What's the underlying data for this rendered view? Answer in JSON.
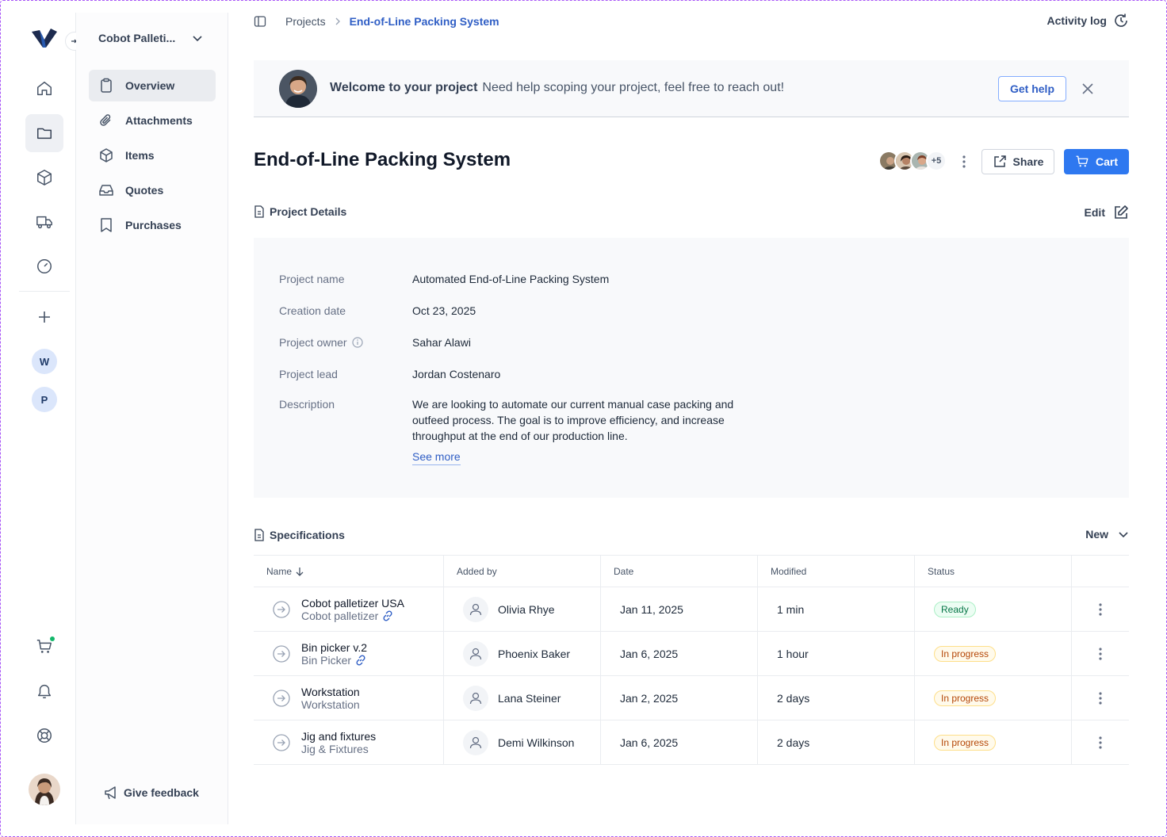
{
  "sidebar": {
    "project_selector": "Cobot Palleti...",
    "items": [
      {
        "label": "Overview",
        "icon": "clipboard-icon"
      },
      {
        "label": "Attachments",
        "icon": "paperclip-icon"
      },
      {
        "label": "Items",
        "icon": "box-icon"
      },
      {
        "label": "Quotes",
        "icon": "inbox-icon"
      },
      {
        "label": "Purchases",
        "icon": "bookmark-icon"
      }
    ],
    "feedback": "Give feedback"
  },
  "rail": {
    "workspaces": [
      "W",
      "P"
    ]
  },
  "breadcrumb": {
    "root": "Projects",
    "current": "End-of-Line Packing System"
  },
  "header": {
    "activity_log": "Activity log"
  },
  "banner": {
    "title": "Welcome to your project",
    "message": "Need help scoping your project, feel free to reach out!",
    "button": "Get help"
  },
  "project": {
    "title": "End-of-Line Packing System",
    "collaborators_more": "+5",
    "share": "Share",
    "cart": "Cart"
  },
  "details": {
    "heading": "Project Details",
    "edit": "Edit",
    "rows": {
      "name_label": "Project name",
      "name_value": "Automated End-of-Line Packing System",
      "date_label": "Creation date",
      "date_value": "Oct 23, 2025",
      "owner_label": "Project owner",
      "owner_value": "Sahar Alawi",
      "lead_label": "Project lead",
      "lead_value": "Jordan Costenaro",
      "desc_label": "Description",
      "desc_value": "We are looking to automate our current manual case packing and outfeed process. The goal is to improve efficiency, and increase throughput at the end of our production line.",
      "see_more": "See more"
    }
  },
  "specs": {
    "heading": "Specifications",
    "new": "New",
    "columns": [
      "Name",
      "Added by",
      "Date",
      "Modified",
      "Status"
    ],
    "rows": [
      {
        "name": "Cobot palletizer USA",
        "type": "Cobot palletizer",
        "added_by": "Olivia Rhye",
        "date": "Jan 11, 2025",
        "modified": "1 min",
        "status": "Ready"
      },
      {
        "name": "Bin picker v.2",
        "type": "Bin Picker",
        "added_by": "Phoenix Baker",
        "date": "Jan 6, 2025",
        "modified": "1 hour",
        "status": "In progress"
      },
      {
        "name": "Workstation",
        "type": "Workstation",
        "added_by": "Lana Steiner",
        "date": "Jan 2, 2025",
        "modified": "2 days",
        "status": "In progress"
      },
      {
        "name": "Jig and fixtures",
        "type": "Jig & Fixtures",
        "added_by": "Demi Wilkinson",
        "date": "Jan 6, 2025",
        "modified": "2 days",
        "status": "In progress"
      }
    ]
  },
  "colors": {
    "accent": "#2e78f0",
    "link": "#2f5ec5",
    "ready": "#067647",
    "in_progress": "#b54708"
  }
}
